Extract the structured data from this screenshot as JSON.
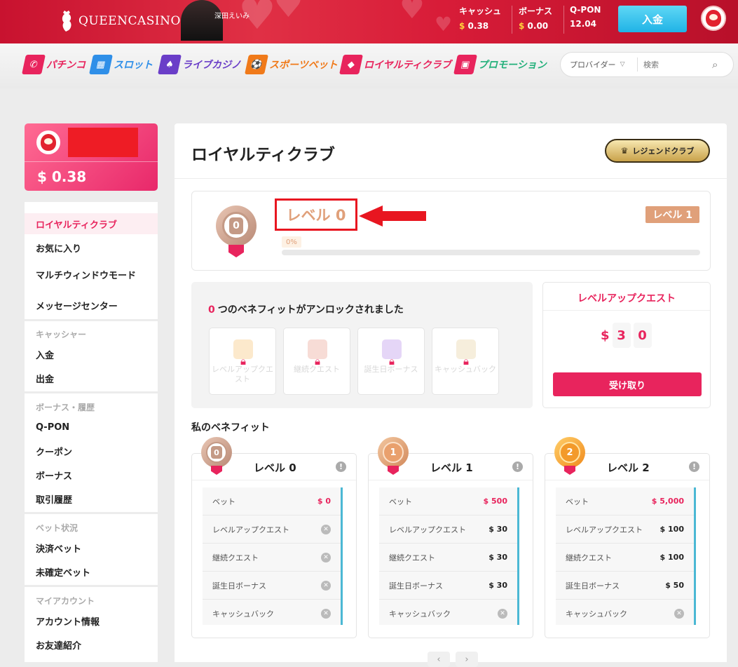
{
  "header": {
    "brand": "QUEENCASINO",
    "model_name": "深田えいみ",
    "cash_label": "キャッシュ",
    "cash_value": "0.38",
    "bonus_label": "ボーナス",
    "bonus_value": "0.00",
    "qpon_label": "Q-PON",
    "qpon_value": "12.04",
    "currency": "$",
    "deposit_button": "入金"
  },
  "nav": {
    "items": [
      {
        "label": "パチンコ",
        "color": "#e8245d"
      },
      {
        "label": "スロット",
        "color": "#2f8fe8"
      },
      {
        "label": "ライブカジノ",
        "color": "#6a3ec8"
      },
      {
        "label": "スポーツベット",
        "color": "#f07a1a"
      },
      {
        "label": "ロイヤルティクラブ",
        "color": "#e8245d"
      },
      {
        "label": "プロモーション",
        "color": "#22b07a"
      }
    ],
    "provider_label": "プロバイダー",
    "search_placeholder": "検索"
  },
  "sidebar": {
    "balance": "$ 0.38",
    "menu": [
      {
        "label": "ロイヤルティクラブ",
        "active": true
      },
      {
        "label": "お気に入り"
      },
      {
        "label": "マルチウィンドウモード"
      },
      {
        "label": "メッセージセンター"
      }
    ],
    "sections": [
      {
        "heading": "キャッシャー",
        "items": [
          "入金",
          "出金"
        ]
      },
      {
        "heading": "ボーナス・履歴",
        "items": [
          "Q-PON",
          "クーポン",
          "ボーナス",
          "取引履歴"
        ]
      },
      {
        "heading": "ベット状況",
        "items": [
          "決済ベット",
          "未確定ベット"
        ]
      },
      {
        "heading": "マイアカウント",
        "items": [
          "アカウント情報",
          "お友達紹介"
        ]
      }
    ]
  },
  "main": {
    "title": "ロイヤルティクラブ",
    "legend_button": "レジェンドクラブ",
    "current_level_label": "レベル 0",
    "current_level_medal": "0",
    "next_level_label": "レベル 1",
    "progress_text": "0%",
    "progress_fraction": 0,
    "benefits_count": "0",
    "benefits_text": "つのベネフィットがアンロックされました",
    "locked_benefits": [
      "レベルアップクエスト",
      "継続クエスト",
      "誕生日ボーナス",
      "キャッシュバック"
    ],
    "quest_title": "レベルアップクエスト",
    "quest_currency": "$",
    "quest_digits": [
      "3",
      "0"
    ],
    "quest_button": "受け取り",
    "my_benefits_title": "私のベネフィット"
  },
  "levels": [
    {
      "medal": "0",
      "name": "レベル 0",
      "info": "!",
      "rows": [
        {
          "label": "ベット",
          "value": "$ 0",
          "pink": true
        },
        {
          "label": "レベルアップクエスト",
          "value": null
        },
        {
          "label": "継続クエスト",
          "value": null
        },
        {
          "label": "誕生日ボーナス",
          "value": null
        },
        {
          "label": "キャッシュバック",
          "value": null
        }
      ]
    },
    {
      "medal": "1",
      "name": "レベル 1",
      "info": "!",
      "rows": [
        {
          "label": "ベット",
          "value": "$ 500",
          "pink": true
        },
        {
          "label": "レベルアップクエスト",
          "value": "$ 30"
        },
        {
          "label": "継続クエスト",
          "value": "$ 30"
        },
        {
          "label": "誕生日ボーナス",
          "value": "$ 30"
        },
        {
          "label": "キャッシュバック",
          "value": null
        }
      ]
    },
    {
      "medal": "2",
      "name": "レベル 2",
      "info": "!",
      "rows": [
        {
          "label": "ベット",
          "value": "$ 5,000",
          "pink": true
        },
        {
          "label": "レベルアップクエスト",
          "value": "$ 100"
        },
        {
          "label": "継続クエスト",
          "value": "$ 100"
        },
        {
          "label": "誕生日ボーナス",
          "value": "$ 50"
        },
        {
          "label": "キャッシュバック",
          "value": null
        }
      ]
    }
  ],
  "pager": {
    "prev": "‹",
    "next": "›"
  }
}
